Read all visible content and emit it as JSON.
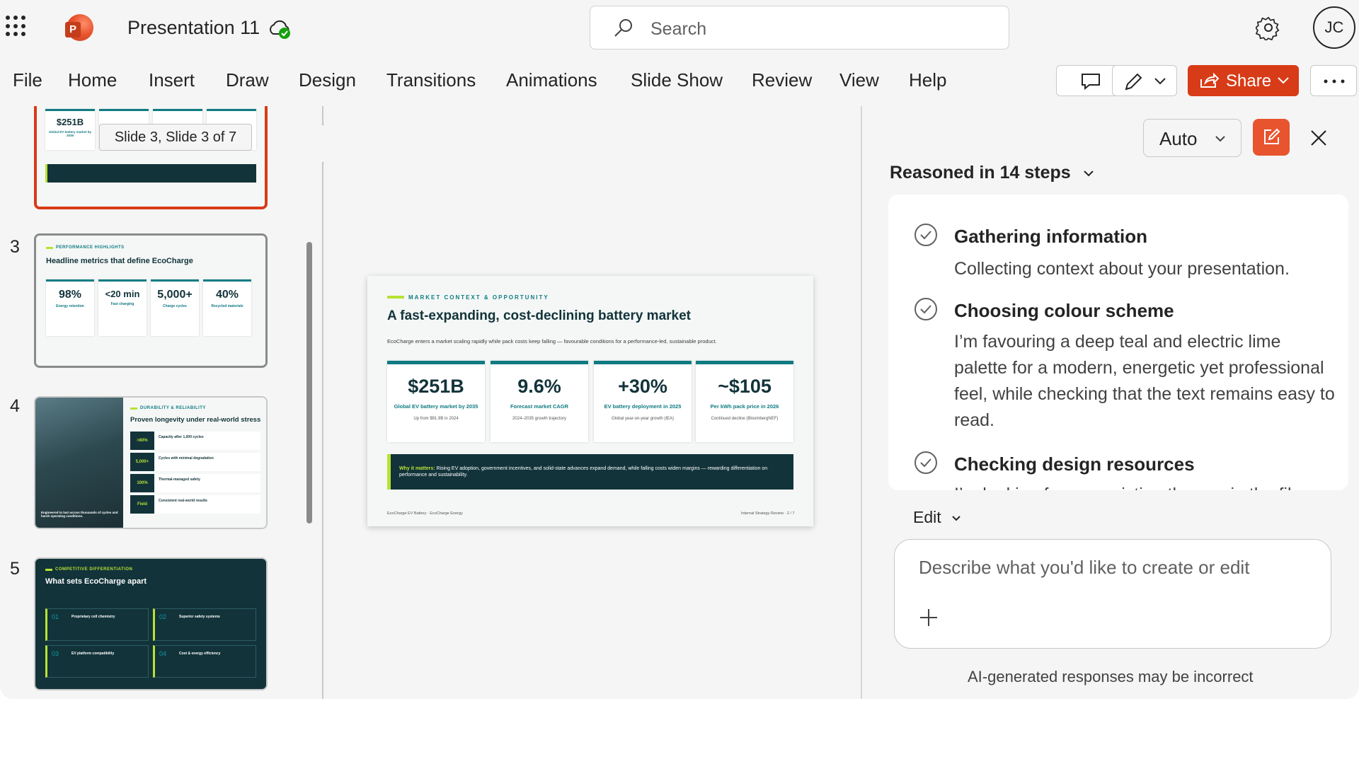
{
  "app": {
    "title": "Presentation 11",
    "search_placeholder": "Search",
    "user_initials": "JC",
    "accent": "#d83b17"
  },
  "ribbon": {
    "tabs": [
      "File",
      "Home",
      "Insert",
      "Draw",
      "Design",
      "Transitions",
      "Animations",
      "Slide Show",
      "Review",
      "View",
      "Help"
    ],
    "share_label": "Share"
  },
  "thumbnails": {
    "tooltip": "Slide 3, Slide 3 of 7",
    "slide2": {
      "stat": "$251B",
      "stat_label": "Global EV battery market by 2035"
    },
    "slide3": {
      "number": "3",
      "kicker": "PERFORMANCE HIGHLIGHTS",
      "title": "Headline metrics that define EcoCharge",
      "metrics": [
        {
          "value": "98%",
          "label": "Energy retention"
        },
        {
          "value": "<20 min",
          "label": "Fast charging"
        },
        {
          "value": "5,000+",
          "label": "Charge cycles"
        },
        {
          "value": "40%",
          "label": "Recycled materials"
        }
      ]
    },
    "slide4": {
      "number": "4",
      "kicker": "DURABILITY & RELIABILITY",
      "title": "Proven longevity under real-world stress",
      "rows": [
        {
          "badge": ">80%",
          "text": "Capacity after 1,000 cycles"
        },
        {
          "badge": "5,000+",
          "text": "Cycles with minimal degradation"
        },
        {
          "badge": "100%",
          "text": "Thermal-managed safety"
        },
        {
          "badge": "Field",
          "text": "Consistent real-world results"
        }
      ],
      "caption": "Engineered to last across thousands of cycles and harsh operating conditions."
    },
    "slide5": {
      "number": "5",
      "kicker": "COMPETITIVE DIFFERENTIATION",
      "title": "What sets EcoCharge apart",
      "items": [
        {
          "num": "01",
          "title": "Proprietary cell chemistry"
        },
        {
          "num": "02",
          "title": "Superior safety systems"
        },
        {
          "num": "03",
          "title": "EV platform compatibility"
        },
        {
          "num": "04",
          "title": "Cost & energy efficiency"
        }
      ]
    }
  },
  "slide": {
    "kicker": "MARKET CONTEXT & OPPORTUNITY",
    "title": "A fast-expanding, cost-declining battery market",
    "subtitle": "EcoCharge enters a market scaling rapidly while pack costs keep falling — favourable conditions for a performance-led, sustainable product.",
    "kpis": [
      {
        "value": "$251B",
        "label": "Global EV battery market by 2035",
        "sub": "Up from $91.9B in 2024"
      },
      {
        "value": "9.6%",
        "label": "Forecast market CAGR",
        "sub": "2024–2035 growth trajectory"
      },
      {
        "value": "+30%",
        "label": "EV battery deployment in 2025",
        "sub": "Global year-on-year growth (IEA)"
      },
      {
        "value": "~$105",
        "label": "Per kWh pack price in 2026",
        "sub": "Continued decline (BloombergNEF)"
      }
    ],
    "why_label": "Why it matters:",
    "why_text": "Rising EV adoption, government incentives, and solid-state advances expand demand, while falling costs widen margins — rewarding differentiation on performance and sustainability.",
    "footer_left": "EcoCharge EV Battery · EcoCharge Energy",
    "footer_right": "Internal Strategy Review · 2 / 7"
  },
  "copilot": {
    "mode": "Auto",
    "reasoned": "Reasoned in 14 steps",
    "steps": [
      {
        "title": "Gathering information",
        "desc": "Collecting context about your presentation."
      },
      {
        "title": "Choosing colour scheme",
        "desc": "I’m favouring a deep teal and electric lime palette for a modern, energetic yet professional feel, while checking that the text remains easy to read."
      },
      {
        "title": "Checking design resources",
        "desc": "I’m looking for any existing themes in the files."
      }
    ],
    "edit_mode": "Edit",
    "prompt_placeholder": "Describe what you'd like to create or edit",
    "disclaimer": "AI-generated responses may be incorrect"
  }
}
